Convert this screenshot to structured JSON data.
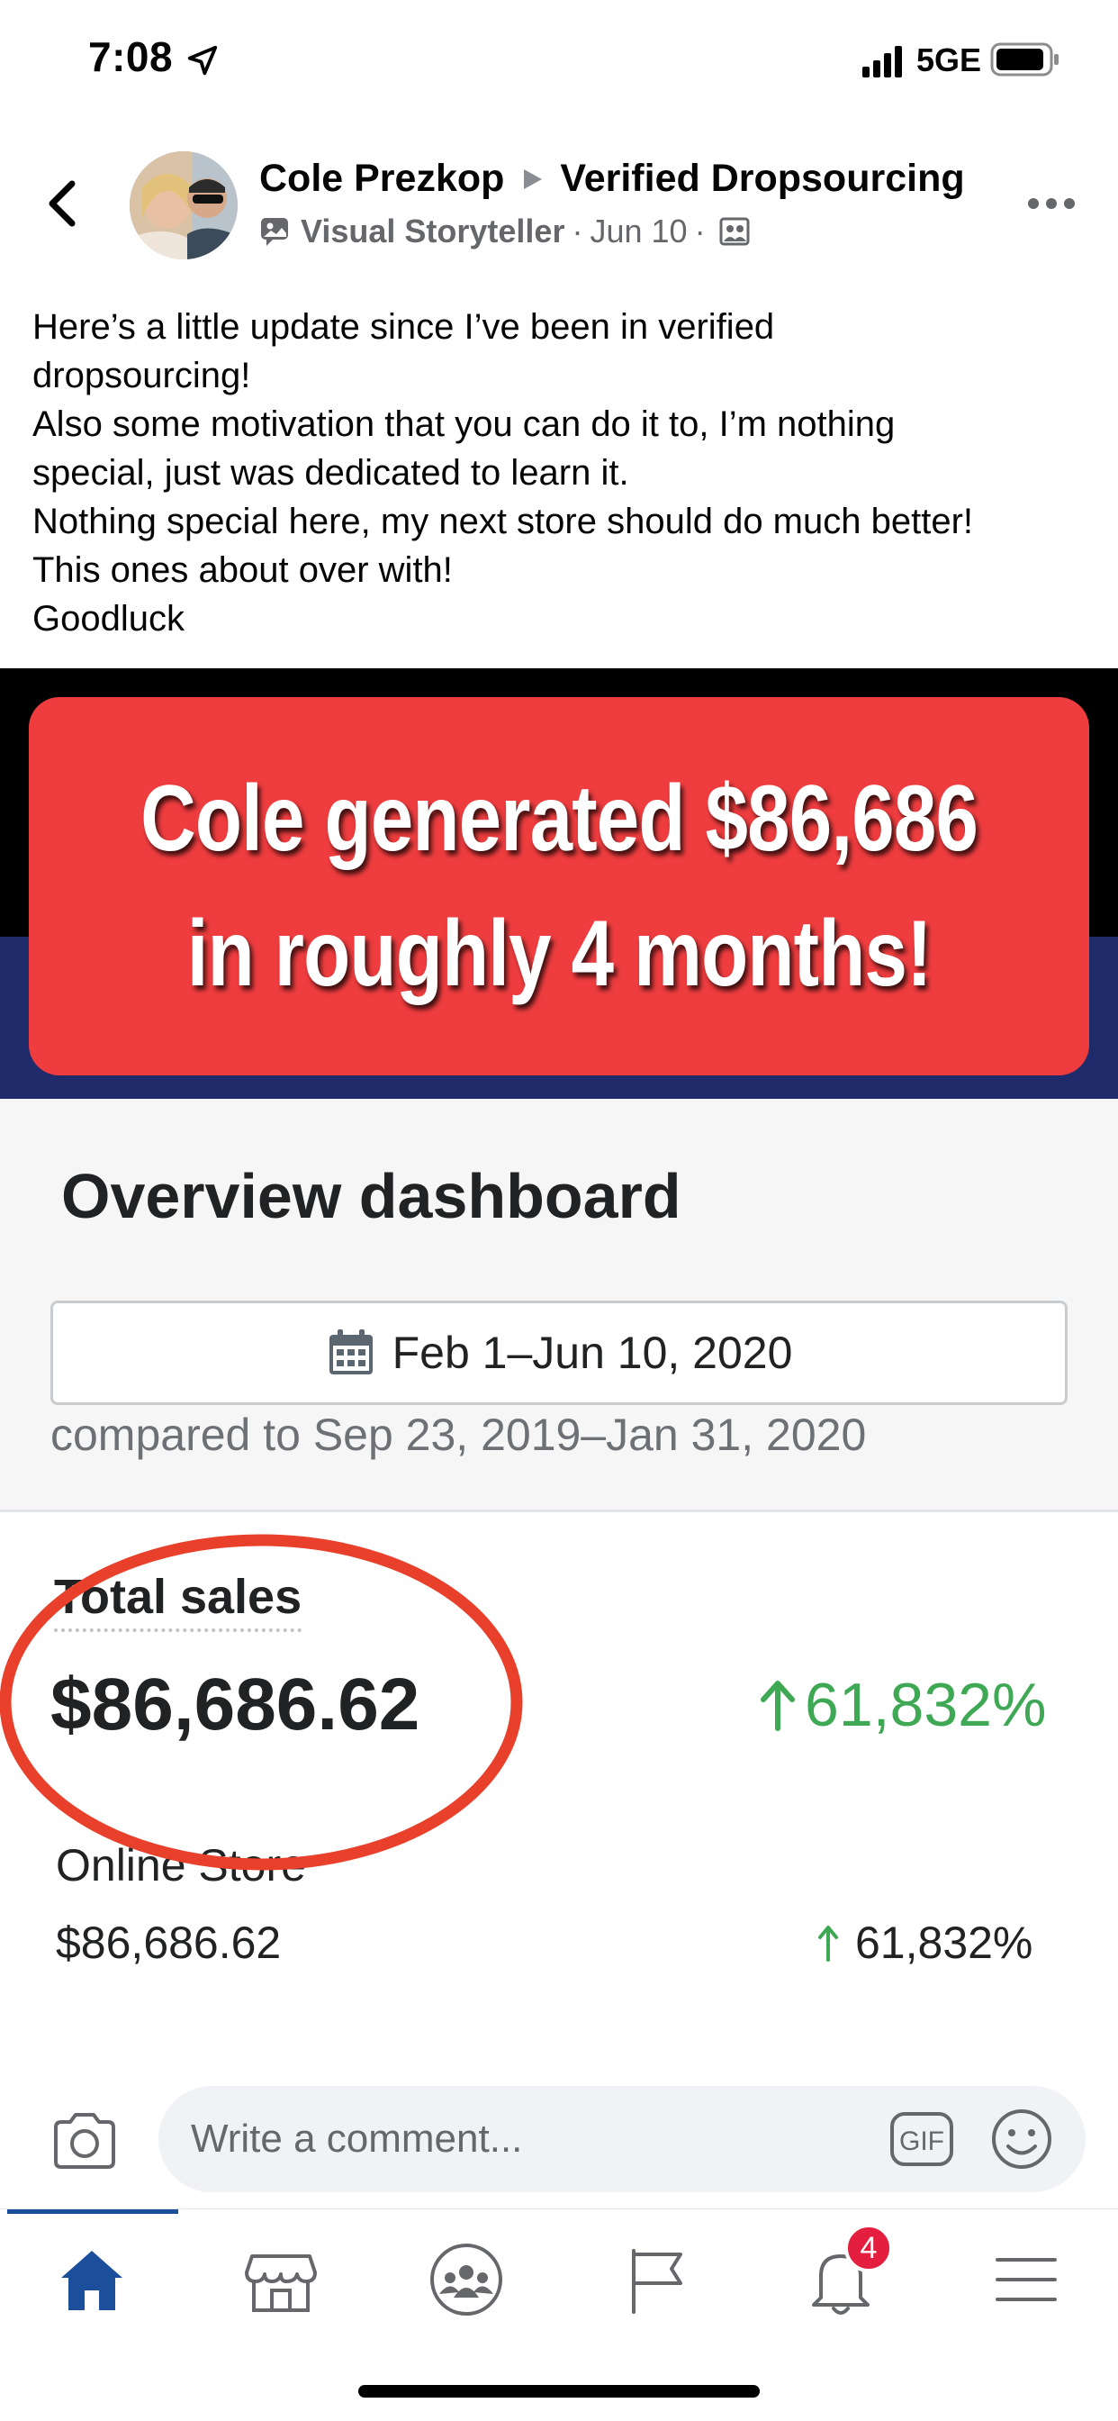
{
  "status_bar": {
    "time": "7:08",
    "network": "5GE"
  },
  "post": {
    "author": "Cole Prezkop",
    "group": "Verified Dropsourcing",
    "badge": "Visual Storyteller",
    "date": "Jun 10",
    "separator": "·",
    "text_lines": [
      "Here’s a little update since I’ve been in verified",
      "dropsourcing!",
      "Also some motivation that you can do it to, I’m nothing",
      "special, just was dedicated to learn it.",
      "Nothing special here, my next store should do much better!",
      "This ones about over with!",
      "Goodluck"
    ]
  },
  "image": {
    "banner_lines": [
      "Cole generated $86,686",
      "in roughly 4 months!"
    ],
    "dashboard_title": "Overview dashboard",
    "date_range": "Feb 1–Jun 10, 2020",
    "compared_to": "compared to Sep 23, 2019–Jan 31, 2020",
    "total_sales_label": "Total sales",
    "total_sales_value": "$86,686.62",
    "total_sales_change": "61,832%",
    "online_store_label": "Online Store",
    "online_store_value": "$86,686.62",
    "online_store_change": "61,832%",
    "colors": {
      "banner": "#ef3d3f",
      "up": "#3fa854",
      "navy": "#1f2a6b"
    }
  },
  "comment_bar": {
    "placeholder": "Write a comment...",
    "gif_label": "GIF"
  },
  "tab_bar": {
    "tabs": [
      "home-icon",
      "marketplace-icon",
      "groups-icon",
      "pages-flag-icon",
      "notifications-bell-icon",
      "menu-icon"
    ],
    "notification_count": "4",
    "active_color": "#1b4f9c"
  }
}
